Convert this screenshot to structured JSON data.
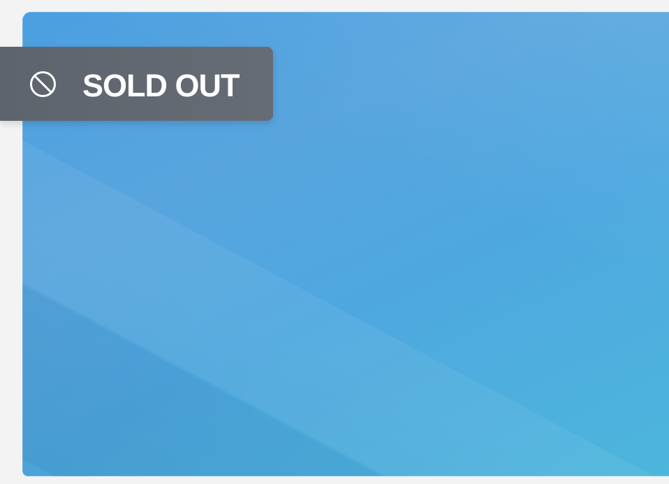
{
  "product_card": {
    "badge": {
      "label": "SOLD OUT",
      "icon": "prohibited-icon"
    }
  },
  "colors": {
    "page_background": "#f3f3f4",
    "image_blue": "#4ea8df",
    "badge_background": "#636972",
    "badge_text": "#ffffff"
  }
}
